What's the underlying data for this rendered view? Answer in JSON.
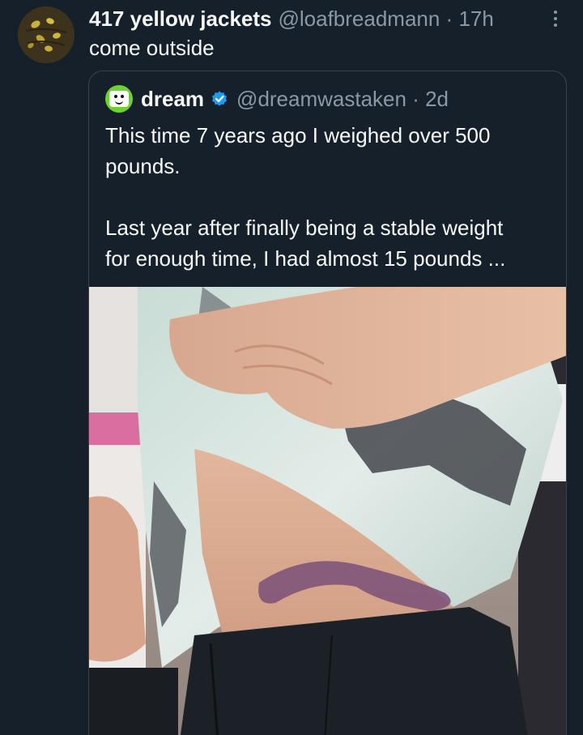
{
  "tweet": {
    "avatar": "yellow-jackets-avatar",
    "display_name": "417 yellow jackets",
    "handle_time": "@loafbreadmann · 17h",
    "text": "come outside",
    "more_icon": "more-dots-icon"
  },
  "quote": {
    "avatar": "dream-avatar",
    "display_name": "dream",
    "verified_icon": "verified-badge-icon",
    "handle_time": "@dreamwastaken · 2d",
    "paragraph1": "This time 7 years ago I weighed over 500\npounds.",
    "paragraph2": "Last year after finally being a stable weight\nfor enough time, I had almost 15 pounds ...",
    "media": "photo-attachment"
  },
  "colors": {
    "background": "#15202b",
    "primary_text": "#f7f9f9",
    "secondary_text": "#8b98a5",
    "border": "#38444d",
    "verified": "#1d9bf0"
  }
}
